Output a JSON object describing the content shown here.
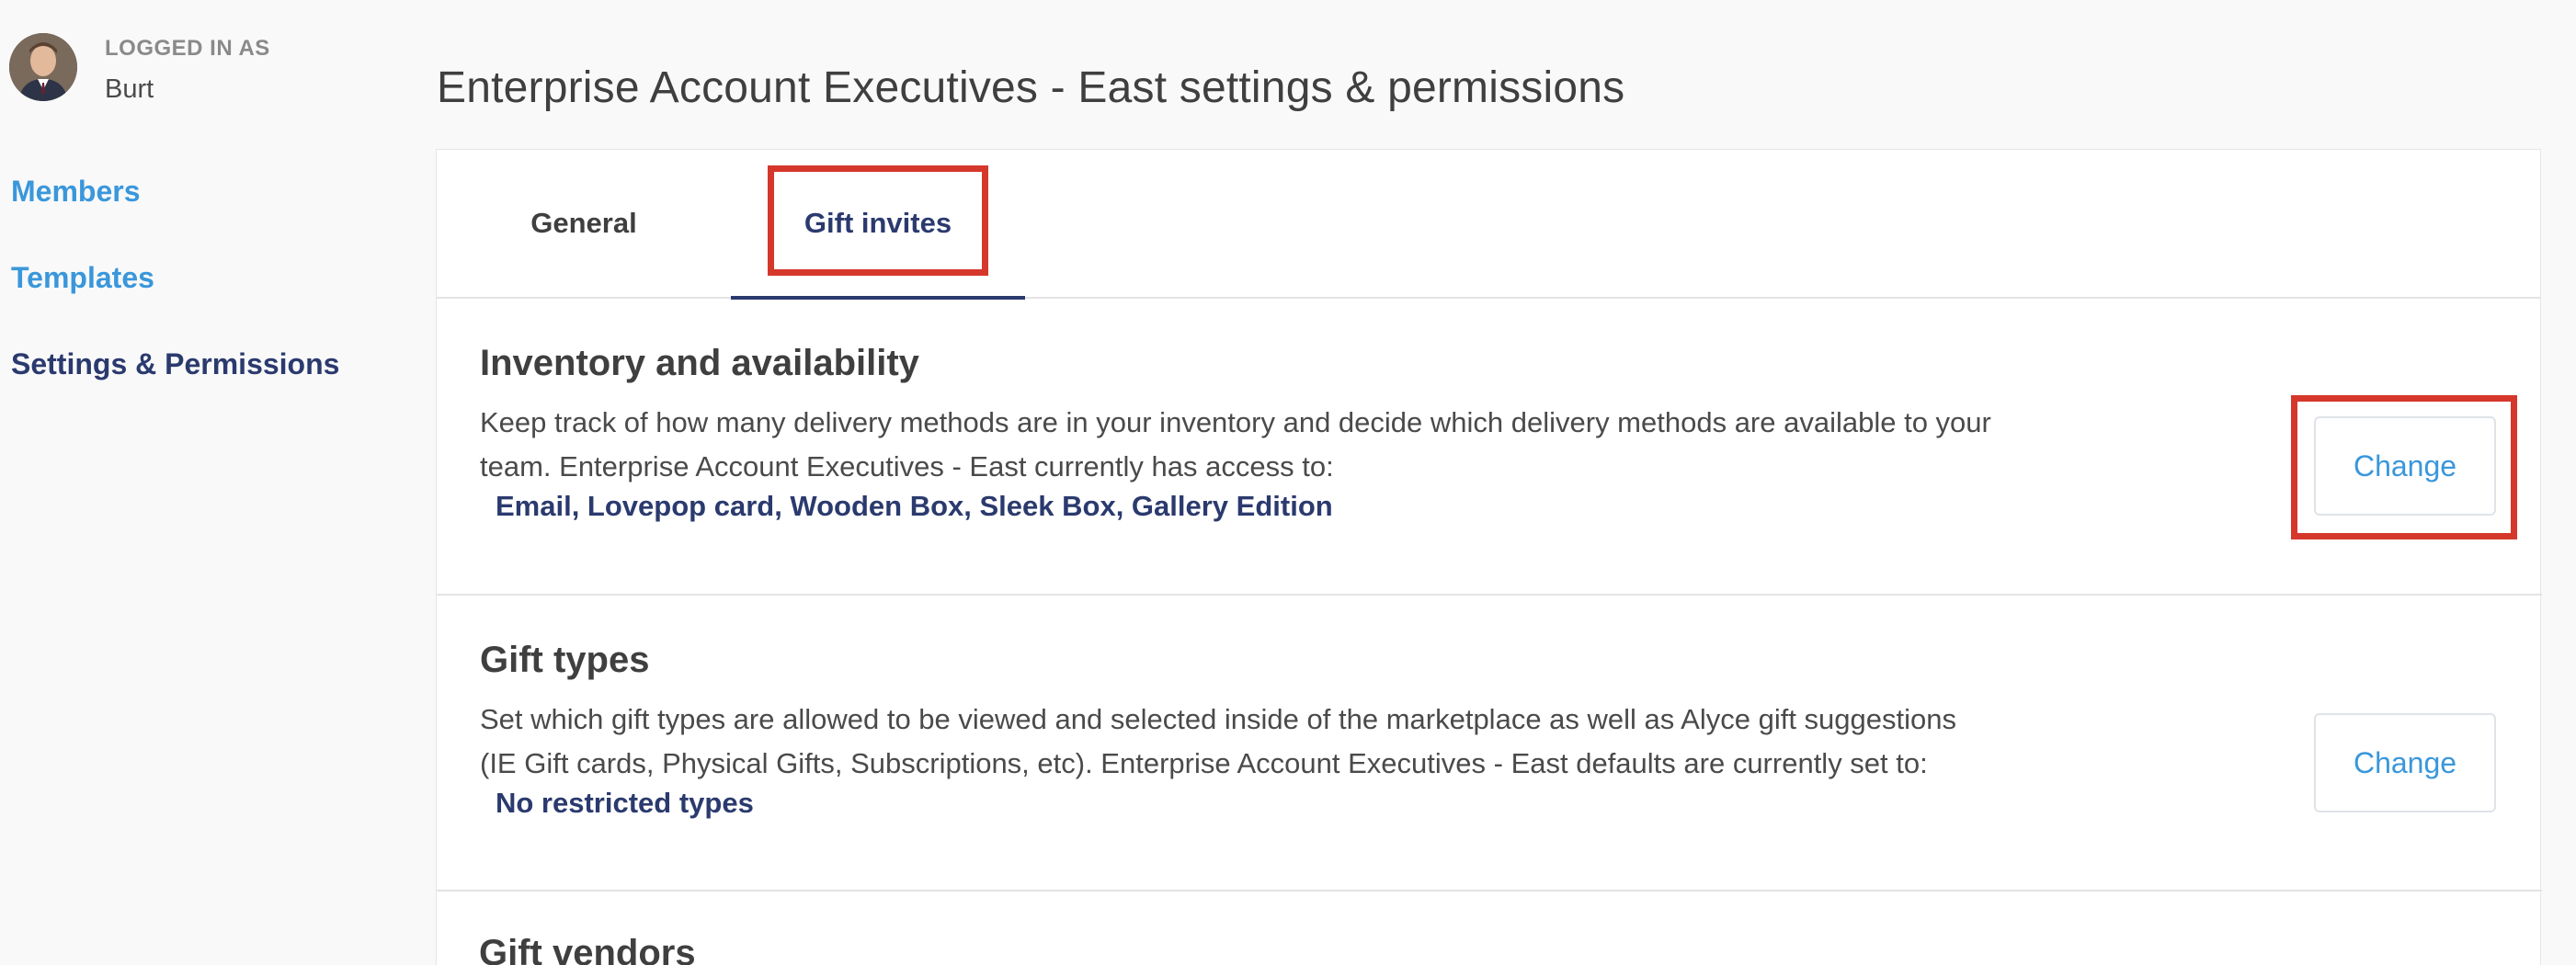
{
  "user": {
    "logged_in_label": "LOGGED IN AS",
    "name": "Burt"
  },
  "sidebar": {
    "items": [
      {
        "label": "Members",
        "active": false
      },
      {
        "label": "Templates",
        "active": false
      },
      {
        "label": "Settings & Permissions",
        "active": true
      }
    ]
  },
  "page": {
    "title": "Enterprise Account Executives - East settings & permissions"
  },
  "tabs": [
    {
      "label": "General",
      "active": false
    },
    {
      "label": "Gift invites",
      "active": true
    }
  ],
  "sections": {
    "inventory": {
      "title": "Inventory and availability",
      "description": "Keep track of how many delivery methods are in your inventory and decide which delivery methods are available to your team. Enterprise Account Executives - East currently has access to:",
      "value": "Email, Lovepop card, Wooden Box, Sleek Box, Gallery Edition",
      "button_label": "Change"
    },
    "gift_types": {
      "title": "Gift types",
      "description": "Set which gift types are allowed to be viewed and selected inside of the marketplace as well as Alyce gift suggestions (IE Gift cards, Physical Gifts, Subscriptions, etc). Enterprise Account Executives - East defaults are currently set to:",
      "value": "No restricted types",
      "button_label": "Change"
    },
    "gift_vendors": {
      "title": "Gift vendors"
    }
  },
  "colors": {
    "accent_link": "#3a97db",
    "active_navy": "#2b3a6e",
    "highlight_red": "#d5372b",
    "page_bg": "#f9f9f9"
  },
  "icons": {
    "avatar": "user-avatar-photo"
  }
}
